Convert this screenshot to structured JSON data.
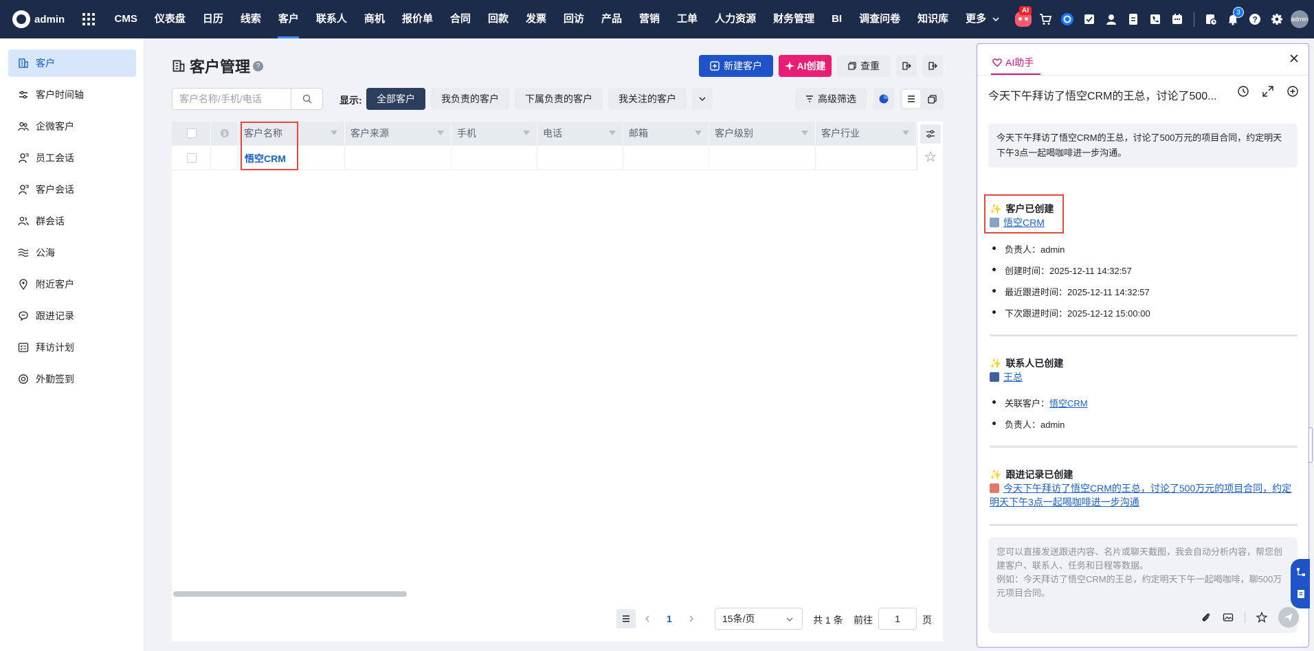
{
  "topnav": {
    "brand": "admin",
    "items": [
      "CMS",
      "仪表盘",
      "日历",
      "线索",
      "客户",
      "联系人",
      "商机",
      "报价单",
      "合同",
      "回款",
      "发票",
      "回访",
      "产品",
      "营销",
      "工单",
      "人力资源",
      "财务管理",
      "BI",
      "调查问卷",
      "知识库",
      "更多"
    ],
    "active_item": "客户",
    "ai_badge": "AI",
    "notification_count": "3",
    "avatar_label": "admin"
  },
  "sidebar": {
    "items": [
      {
        "label": "客户",
        "icon": "building-icon"
      },
      {
        "label": "客户时间轴",
        "icon": "timeline-icon"
      },
      {
        "label": "企微客户",
        "icon": "wecom-users-icon"
      },
      {
        "label": "员工会话",
        "icon": "person-chat-icon"
      },
      {
        "label": "客户会话",
        "icon": "person-chat-icon"
      },
      {
        "label": "群会话",
        "icon": "group-icon"
      },
      {
        "label": "公海",
        "icon": "waves-icon"
      },
      {
        "label": "附近客户",
        "icon": "location-pin-icon"
      },
      {
        "label": "跟进记录",
        "icon": "chat-bubble-icon"
      },
      {
        "label": "拜访计划",
        "icon": "checklist-icon"
      },
      {
        "label": "外勤签到",
        "icon": "target-icon"
      }
    ]
  },
  "main": {
    "title": "客户管理",
    "help": "?",
    "buttons": {
      "new_customer": "新建客户",
      "ai_create": "AI创建",
      "dedupe": "查重"
    },
    "search_placeholder": "客户名称/手机/电话",
    "show_label": "显示:",
    "filter_tabs": [
      "全部客户",
      "我负责的客户",
      "下属负责的客户",
      "我关注的客户"
    ],
    "advanced_filter": "高级筛选",
    "columns": [
      "客户名称",
      "客户来源",
      "手机",
      "电话",
      "邮箱",
      "客户级别",
      "客户行业"
    ],
    "rows": [
      {
        "name": "悟空CRM"
      }
    ],
    "pagination": {
      "current_page": "1",
      "page_size": "15条/页",
      "total": "共 1 条",
      "goto_label": "前往",
      "goto_value": "1",
      "page_unit": "页"
    }
  },
  "ai_panel": {
    "tab_label": "AI助手",
    "conversation_title": "今天下午拜访了悟空CRM的王总，讨论了500...",
    "user_message": "今天下午拜访了悟空CRM的王总，讨论了500万元的项目合同，约定明天下午3点一起喝咖啡进一步沟通。",
    "results": {
      "customer": {
        "heading": "客户已创建",
        "link": "悟空CRM",
        "details": [
          "负责人：admin",
          "创建时间：2025-12-11 14:32:57",
          "最近跟进时间：2025-12-11 14:32:57",
          "下次跟进时间：2025-12-12 15:00:00"
        ]
      },
      "contact": {
        "heading": "联系人已创建",
        "link": "王总",
        "related_label": "关联客户：",
        "related_link": "悟空CRM",
        "owner": "负责人：admin"
      },
      "followup": {
        "heading": "跟进记录已创建",
        "link": "今天下午拜访了悟空CRM的王总，讨论了500万元的项目合同，约定明天下午3点一起喝咖啡进一步沟通"
      }
    },
    "input_placeholder_line1": "您可以直接发送跟进内容、名片或聊天截图，我会自动分析内容，帮您创建客户、联系人、任务和日程等数据。",
    "input_placeholder_line2": "例如：今天拜访了悟空CRM的王总，约定明天下午一起喝咖啡，聊500万元项目合同。"
  },
  "colors": {
    "nav_bg": "#1d2b4b",
    "primary": "#1d52c8",
    "ai_pink": "#ea1d74",
    "link": "#1660c8",
    "highlight_red": "#e8453c"
  }
}
